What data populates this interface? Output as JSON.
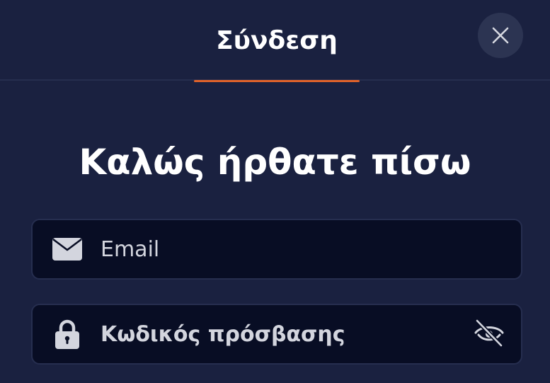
{
  "header": {
    "tab_label": "Σύνδεση",
    "accent_color": "#e0622a"
  },
  "icons": {
    "close": "close-icon",
    "email": "envelope-icon",
    "password": "lock-icon",
    "visibility": "eye-off-icon"
  },
  "main": {
    "title": "Καλώς ήρθατε πίσω"
  },
  "form": {
    "email_placeholder": "Email",
    "email_value": "",
    "password_placeholder": "Κωδικός πρόσβασης",
    "password_value": ""
  }
}
